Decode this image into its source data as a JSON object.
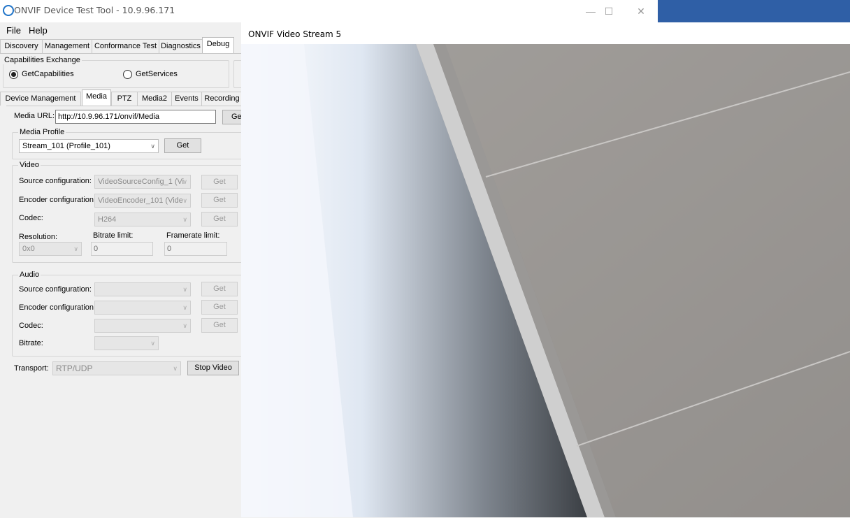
{
  "app": {
    "title": "ONVIF Device Test Tool - 10.9.96.171"
  },
  "window_controls": {
    "minimize": "—",
    "maximize": "☐",
    "close": "✕"
  },
  "menu": {
    "file": "File",
    "help": "Help"
  },
  "main_tabs": [
    "Discovery",
    "Management",
    "Conformance Test",
    "Diagnostics",
    "Debug"
  ],
  "capabilities": {
    "group_title": "Capabilities Exchange",
    "option1": "GetCapabilities",
    "option2": "GetServices",
    "selected": "GetCapabilities"
  },
  "sub_tabs": [
    "Device Management",
    "Media",
    "PTZ",
    "Media2",
    "Events",
    "Recording"
  ],
  "media": {
    "url_label": "Media URL:",
    "url_value": "http://10.9.96.171/onvif/Media",
    "url_button": "Get",
    "profile_group": "Media Profile",
    "profile_value": "Stream_101 (Profile_101)",
    "profile_button": "Get"
  },
  "video": {
    "group_title": "Video",
    "source_label": "Source configuration:",
    "source_value": "VideoSourceConfig_1 (Vi",
    "encoder_label": "Encoder configuration:",
    "encoder_value": "VideoEncoder_101 (Vide",
    "codec_label": "Codec:",
    "codec_value": "H264",
    "get": "Get",
    "resolution_label": "Resolution:",
    "resolution_value": "0x0",
    "bitrate_label": "Bitrate limit:",
    "bitrate_value": "0",
    "framerate_label": "Framerate limit:",
    "framerate_value": "0"
  },
  "audio": {
    "group_title": "Audio",
    "source_label": "Source configuration:",
    "encoder_label": "Encoder configuration:",
    "codec_label": "Codec:",
    "bitrate_label": "Bitrate:",
    "get": "Get"
  },
  "transport": {
    "label": "Transport:",
    "value": "RTP/UDP",
    "stop_button": "Stop Video"
  },
  "video_window": {
    "title": "ONVIF Video Stream 5"
  },
  "colors": {
    "accent": "#2f5fa6",
    "icon": "#1e73c8"
  },
  "icons": {
    "app": "app-ring-icon",
    "dropdown": "chevron-down-icon"
  }
}
